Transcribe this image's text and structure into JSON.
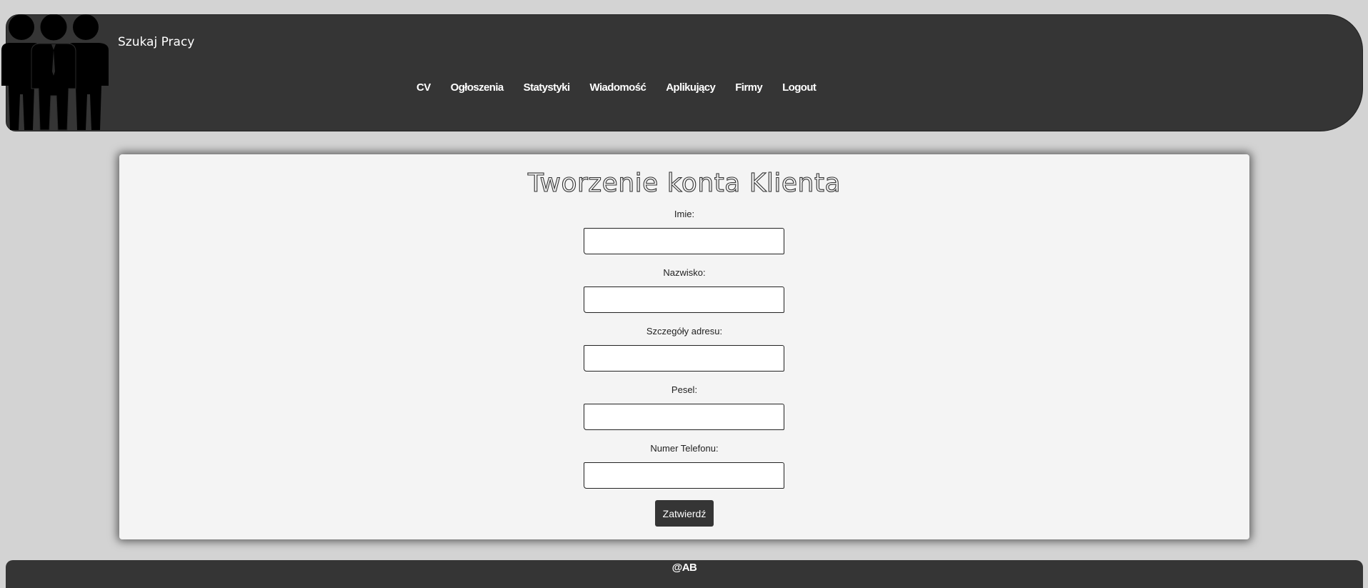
{
  "header": {
    "brand": "Szukaj Pracy",
    "nav": [
      {
        "label": "CV"
      },
      {
        "label": "Ogłoszenia"
      },
      {
        "label": "Statystyki"
      },
      {
        "label": "Wiadomość"
      },
      {
        "label": "Aplikujący"
      },
      {
        "label": "Firmy"
      },
      {
        "label": "Logout"
      }
    ]
  },
  "form": {
    "title": "Tworzenie konta Klienta",
    "fields": [
      {
        "label": "Imie:",
        "value": ""
      },
      {
        "label": "Nazwisko:",
        "value": ""
      },
      {
        "label": "Szczegóły adresu:",
        "value": ""
      },
      {
        "label": "Pesel:",
        "value": ""
      },
      {
        "label": "Numer Telefonu:",
        "value": ""
      }
    ],
    "submit_label": "Zatwierdź"
  },
  "footer": {
    "text": "@AB"
  },
  "colors": {
    "background": "#d3d3d3",
    "header": "#353535",
    "card": "#f4f4f4",
    "button": "#353535"
  },
  "icons": {
    "logo": "business-people-icon"
  }
}
